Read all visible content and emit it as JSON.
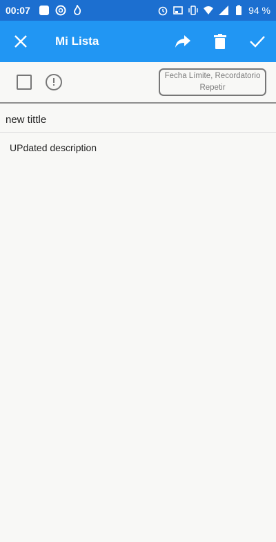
{
  "status_bar": {
    "time": "00:07",
    "battery": "94 %"
  },
  "app_bar": {
    "title": "Mi Lista",
    "colors": {
      "status": "#1c6fd0",
      "bar": "#2196f3"
    }
  },
  "task": {
    "due_button": {
      "line1": "Fecha Límite, Recordatorio",
      "line2": "Repetir"
    },
    "title_value": "new tittle",
    "description_value": "UPdated description"
  }
}
